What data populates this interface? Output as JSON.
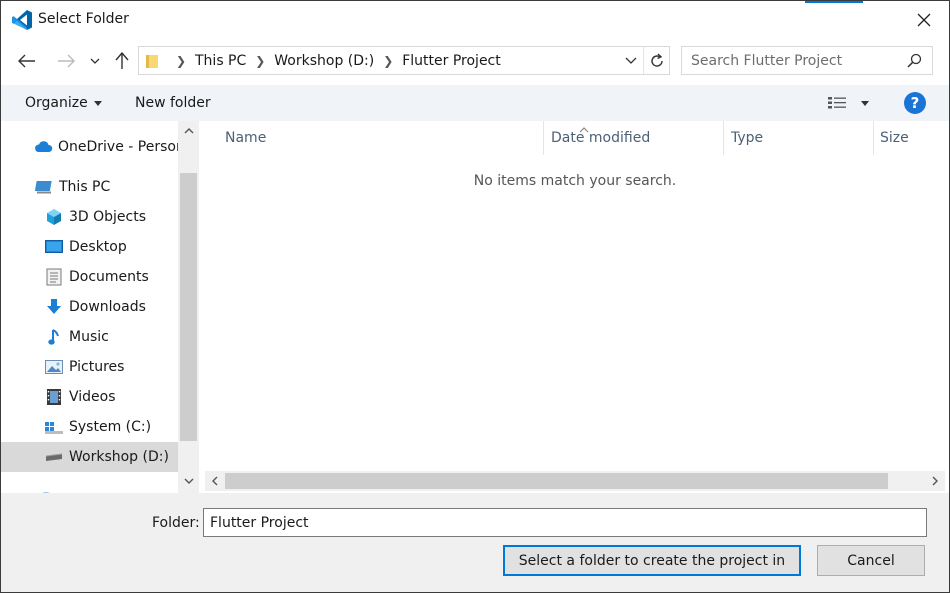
{
  "window": {
    "title": "Select Folder",
    "accent_color": "#0078d7"
  },
  "icons": {
    "app": "vscode-icon",
    "close": "close-icon",
    "back": "back-arrow-icon",
    "forward": "forward-arrow-icon",
    "recent": "chevron-down-icon",
    "up": "up-arrow-icon",
    "refresh": "refresh-icon",
    "search": "search-icon"
  },
  "address": {
    "crumbs": [
      "This PC",
      "Workshop (D:)",
      "Flutter Project"
    ]
  },
  "search": {
    "placeholder": "Search Flutter Project",
    "value": ""
  },
  "toolbar": {
    "organize_label": "Organize",
    "new_folder_label": "New folder",
    "help_label": "?"
  },
  "nav": {
    "items": [
      {
        "label": "OneDrive - Person",
        "icon": "cloud-icon"
      },
      {
        "label": "This PC",
        "icon": "computer-icon"
      },
      {
        "label": "3D Objects",
        "icon": "cube-icon"
      },
      {
        "label": "Desktop",
        "icon": "desktop-icon"
      },
      {
        "label": "Documents",
        "icon": "document-icon"
      },
      {
        "label": "Downloads",
        "icon": "download-icon"
      },
      {
        "label": "Music",
        "icon": "music-note-icon"
      },
      {
        "label": "Pictures",
        "icon": "picture-icon"
      },
      {
        "label": "Videos",
        "icon": "film-icon"
      },
      {
        "label": "System (C:)",
        "icon": "windows-drive-icon"
      },
      {
        "label": "Workshop (D:)",
        "icon": "drive-icon",
        "selected": true
      }
    ]
  },
  "columns": [
    "Name",
    "Date modified",
    "Type",
    "Size"
  ],
  "empty_message": "No items match your search.",
  "footer": {
    "folder_label": "Folder:",
    "folder_value": "Flutter Project",
    "primary_label": "Select a folder to create the project in",
    "cancel_label": "Cancel"
  }
}
